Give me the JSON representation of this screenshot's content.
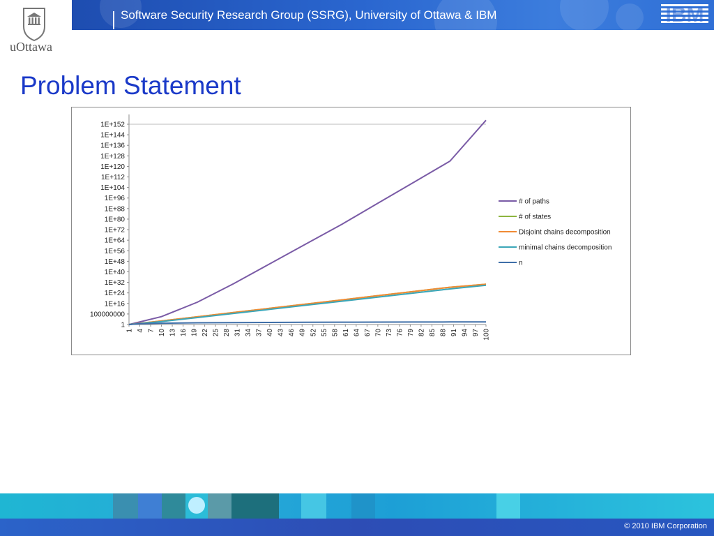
{
  "header": {
    "title": "Software Security Research Group (SSRG), University of Ottawa & IBM",
    "ibm_logo_text": "IBM"
  },
  "branding": {
    "university_name": "uOttawa"
  },
  "slide": {
    "title": "Problem Statement"
  },
  "footer": {
    "copyright": "© 2010 IBM Corporation"
  },
  "colors": {
    "header_blue": "#2a66cf",
    "title_blue": "#1a39c8",
    "footer_cyan": "#1fb6d3"
  },
  "chart_data": {
    "type": "line",
    "scale": "log10",
    "y_tick_labels": [
      "1",
      "100000000",
      "1E+16",
      "1E+24",
      "1E+32",
      "1E+40",
      "1E+48",
      "1E+56",
      "1E+64",
      "1E+72",
      "1E+80",
      "1E+88",
      "1E+96",
      "1E+104",
      "1E+112",
      "1E+120",
      "1E+128",
      "1E+136",
      "1E+144",
      "1E+152"
    ],
    "y_tick_exponents": [
      0,
      8,
      16,
      24,
      32,
      40,
      48,
      56,
      64,
      72,
      80,
      88,
      96,
      104,
      112,
      120,
      128,
      136,
      144,
      152
    ],
    "ylim_exponent": [
      0,
      152
    ],
    "x_tick_labels": [
      "1",
      "4",
      "7",
      "10",
      "13",
      "16",
      "19",
      "22",
      "25",
      "28",
      "31",
      "34",
      "37",
      "40",
      "43",
      "46",
      "49",
      "52",
      "55",
      "58",
      "61",
      "64",
      "67",
      "70",
      "73",
      "76",
      "79",
      "82",
      "85",
      "88",
      "91",
      "94",
      "97",
      "100"
    ],
    "xlim": [
      1,
      100
    ],
    "grid": "major-y-top",
    "legend_position": "right",
    "series": [
      {
        "name": "# of paths",
        "color": "#7a5ba6",
        "points": [
          [
            1,
            0
          ],
          [
            10,
            6
          ],
          [
            20,
            17
          ],
          [
            30,
            31
          ],
          [
            40,
            46
          ],
          [
            50,
            61
          ],
          [
            60,
            76
          ],
          [
            70,
            92
          ],
          [
            80,
            108
          ],
          [
            90,
            124
          ],
          [
            100,
            155
          ]
        ]
      },
      {
        "name": "# of states",
        "color": "#8db53f",
        "points": [
          [
            1,
            0
          ],
          [
            10,
            2.7
          ],
          [
            20,
            5.9
          ],
          [
            30,
            9.1
          ],
          [
            40,
            12.3
          ],
          [
            50,
            15.5
          ],
          [
            60,
            18.7
          ],
          [
            70,
            21.9
          ],
          [
            80,
            25.1
          ],
          [
            90,
            28.3
          ],
          [
            100,
            30.6
          ]
        ]
      },
      {
        "name": "Disjoint chains decomposition",
        "color": "#f08a34",
        "points": [
          [
            1,
            0
          ],
          [
            10,
            2.7
          ],
          [
            20,
            5.9
          ],
          [
            30,
            9.1
          ],
          [
            40,
            12.3
          ],
          [
            50,
            15.5
          ],
          [
            60,
            18.7
          ],
          [
            70,
            21.9
          ],
          [
            80,
            25.1
          ],
          [
            90,
            28.3
          ],
          [
            100,
            30.6
          ]
        ]
      },
      {
        "name": "minimal chains decomposition",
        "color": "#3ba6b8",
        "points": [
          [
            1,
            0
          ],
          [
            10,
            2.3
          ],
          [
            20,
            5.3
          ],
          [
            30,
            8.4
          ],
          [
            40,
            11.5
          ],
          [
            50,
            14.6
          ],
          [
            60,
            17.7
          ],
          [
            70,
            20.8
          ],
          [
            80,
            23.9
          ],
          [
            90,
            27.0
          ],
          [
            100,
            29.8
          ]
        ]
      },
      {
        "name": "n",
        "color": "#3f6fa8",
        "points": [
          [
            1,
            0
          ],
          [
            4,
            0.6
          ],
          [
            10,
            1.0
          ],
          [
            20,
            1.3
          ],
          [
            30,
            1.5
          ],
          [
            40,
            1.6
          ],
          [
            50,
            1.7
          ],
          [
            60,
            1.8
          ],
          [
            70,
            1.85
          ],
          [
            80,
            1.9
          ],
          [
            90,
            1.95
          ],
          [
            100,
            2.0
          ]
        ]
      }
    ]
  }
}
